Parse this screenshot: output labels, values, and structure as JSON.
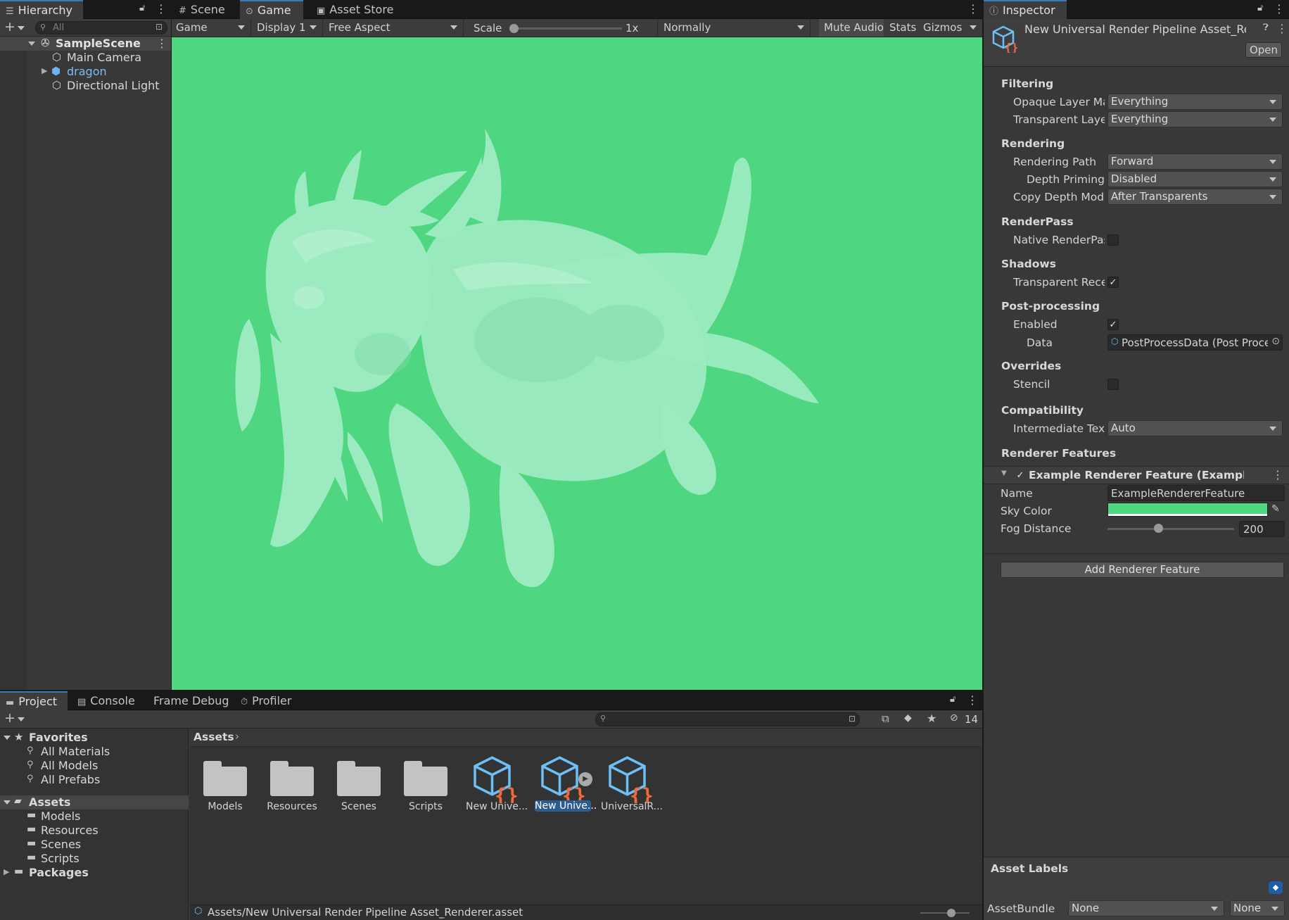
{
  "hierarchy": {
    "tab_label": "Hierarchy",
    "search_placeholder": "All",
    "scene_name": "SampleScene",
    "items": [
      {
        "label": "Main Camera"
      },
      {
        "label": "dragon"
      },
      {
        "label": "Directional Light"
      }
    ]
  },
  "center_tabs": {
    "scene": "Scene",
    "game": "Game",
    "asset_store": "Asset Store"
  },
  "game_toolbar": {
    "view_mode": "Game",
    "display": "Display 1",
    "aspect": "Free Aspect",
    "scale_label": "Scale",
    "scale_value": "1x",
    "play_focus": "Normally",
    "mute_audio": "Mute Audio",
    "stats": "Stats",
    "gizmos": "Gizmos"
  },
  "game_view": {
    "background_color": "#4fd680",
    "model_color": "#9cebc0"
  },
  "inspector": {
    "tab_label": "Inspector",
    "asset_title": "New Universal Render Pipeline Asset_Rer",
    "open_button": "Open",
    "sections": {
      "filtering": "Filtering",
      "rendering": "Rendering",
      "renderpass": "RenderPass",
      "shadows": "Shadows",
      "post_processing": "Post-processing",
      "overrides": "Overrides",
      "compatibility": "Compatibility",
      "renderer_features": "Renderer Features"
    },
    "fields": {
      "opaque_layer_label": "Opaque Layer Ma",
      "opaque_layer_value": "Everything",
      "transparent_layer_label": "Transparent Layer",
      "transparent_layer_value": "Everything",
      "rendering_path_label": "Rendering Path",
      "rendering_path_value": "Forward",
      "depth_priming_label": "Depth Priming M",
      "depth_priming_value": "Disabled",
      "copy_depth_label": "Copy Depth Mode",
      "copy_depth_value": "After Transparents",
      "native_renderpass_label": "Native RenderPas",
      "native_renderpass_checked": false,
      "transparent_receive_label": "Transparent Rece",
      "transparent_receive_checked": true,
      "pp_enabled_label": "Enabled",
      "pp_enabled_checked": true,
      "pp_data_label": "Data",
      "pp_data_value": "PostProcessData (Post Proce",
      "stencil_label": "Stencil",
      "stencil_checked": false,
      "intermediate_label": "Intermediate Text",
      "intermediate_value": "Auto"
    },
    "feature": {
      "title": "Example Renderer Feature (Example Renc",
      "enabled": true,
      "name_label": "Name",
      "name_value": "ExampleRendererFeature",
      "sky_color_label": "Sky Color",
      "sky_color_value": "#4fd680",
      "fog_distance_label": "Fog Distance",
      "fog_distance_value": "200",
      "fog_distance_fraction": 0.4
    },
    "add_feature_button": "Add Renderer Feature",
    "asset_labels": "Asset Labels",
    "assetbundle_label": "AssetBundle",
    "assetbundle_value": "None",
    "assetbundle_variant": "None"
  },
  "bottom_tabs": {
    "project": "Project",
    "console": "Console",
    "frame_debug": "Frame Debug",
    "profiler": "Profiler"
  },
  "project": {
    "hidden_count": "14",
    "favorites_label": "Favorites",
    "favorites": [
      {
        "label": "All Materials"
      },
      {
        "label": "All Models"
      },
      {
        "label": "All Prefabs"
      }
    ],
    "assets_label": "Assets",
    "asset_folders": [
      {
        "label": "Models"
      },
      {
        "label": "Resources"
      },
      {
        "label": "Scenes"
      },
      {
        "label": "Scripts"
      }
    ],
    "packages_label": "Packages",
    "breadcrumb": "Assets",
    "grid_items": [
      {
        "label": "Models"
      },
      {
        "label": "Resources"
      },
      {
        "label": "Scenes"
      },
      {
        "label": "Scripts"
      },
      {
        "label": "New Unive..."
      },
      {
        "label": "New Unive..."
      },
      {
        "label": "UniversalR..."
      }
    ],
    "status_path": "Assets/New Universal Render Pipeline Asset_Renderer.asset"
  }
}
